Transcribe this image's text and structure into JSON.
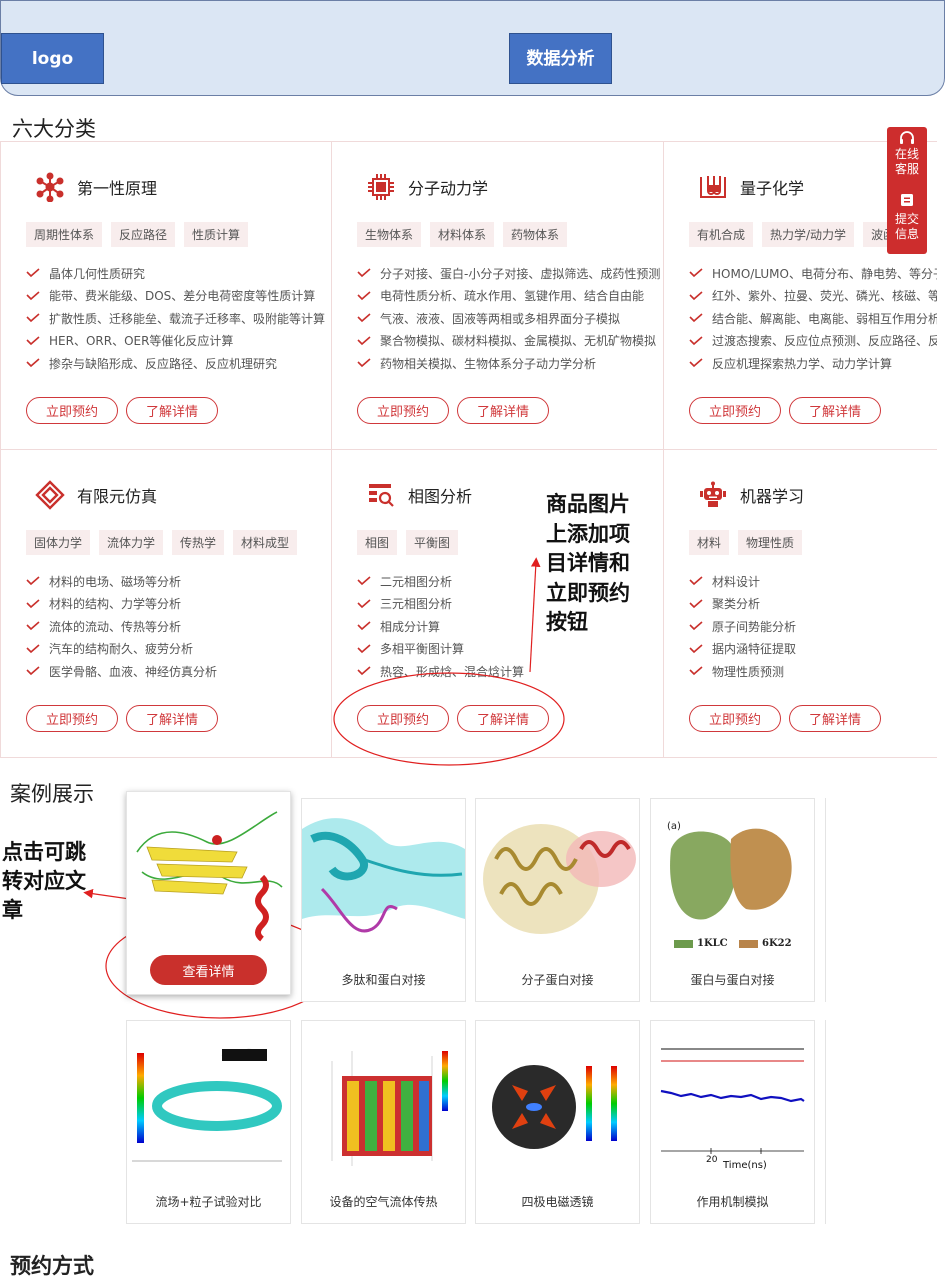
{
  "header": {
    "logo": "logo",
    "data_analysis": "数据分析"
  },
  "categories_title": "六大分类",
  "categories": [
    {
      "title": "第一性原理",
      "icon": "network-nodes-icon",
      "tags": [
        "周期性体系",
        "反应路径",
        "性质计算"
      ],
      "features": [
        "晶体几何性质研究",
        "能带、费米能级、DOS、差分电荷密度等性质计算",
        "扩散性质、迁移能垒、载流子迁移率、吸附能等计算",
        "HER、ORR、OER等催化反应计算",
        "掺杂与缺陷形成、反应路径、反应机理研究"
      ]
    },
    {
      "title": "分子动力学",
      "icon": "chip-icon",
      "tags": [
        "生物体系",
        "材料体系",
        "药物体系"
      ],
      "features": [
        "分子对接、蛋白-小分子对接、虚拟筛选、成药性预测",
        "电荷性质分析、疏水作用、氢键作用、结合自由能",
        "气液、液液、固液等两相或多相界面分子模拟",
        "聚合物模拟、碳材料模拟、金属模拟、无机矿物模拟",
        "药物相关模拟、生物体系分子动力学分析"
      ]
    },
    {
      "title": "量子化学",
      "icon": "test-tubes-icon",
      "tags": [
        "有机合成",
        "热力学/动力学",
        "波函数"
      ],
      "features": [
        "HOMO/LUMO、电荷分布、静电势、等分子性质",
        "红外、紫外、拉曼、荧光、磷光、核磁、等光谱",
        "结合能、解离能、电离能、弱相互作用分析等",
        "过渡态搜索、反应位点预测、反应路径、反应机理",
        "反应机理探索热力学、动力学计算"
      ]
    },
    {
      "title": "有限元仿真",
      "icon": "diamond-mesh-icon",
      "tags": [
        "固体力学",
        "流体力学",
        "传热学",
        "材料成型"
      ],
      "features": [
        "材料的电场、磁场等分析",
        "材料的结构、力学等分析",
        "流体的流动、传热等分析",
        "汽车的结构耐久、疲劳分析",
        "医学骨骼、血液、神经仿真分析"
      ]
    },
    {
      "title": "相图分析",
      "icon": "phase-search-icon",
      "tags": [
        "相图",
        "平衡图"
      ],
      "features": [
        "二元相图分析",
        "三元相图分析",
        "相成分计算",
        "多相平衡图计算",
        "热容、形成焓、混合焓计算"
      ]
    },
    {
      "title": "机器学习",
      "icon": "robot-icon",
      "tags": [
        "材料",
        "物理性质"
      ],
      "features": [
        "材料设计",
        "聚类分析",
        "原子间势能分析",
        "据内涵特征提取",
        "物理性质预测"
      ]
    }
  ],
  "buttons": {
    "book": "立即预约",
    "details": "了解详情"
  },
  "side_float": {
    "service": "在线客服",
    "submit": "提交信息"
  },
  "annotations": {
    "product_note": "商品图片上添加项目详情和立即预约按钮",
    "click_note": "点击可跳转对应文章"
  },
  "cases_title": "案例展示",
  "cases": [
    {
      "label": "",
      "button": "查看详情"
    },
    {
      "label": "多肽和蛋白对接"
    },
    {
      "label": "分子蛋白对接"
    },
    {
      "label": "蛋白与蛋白对接",
      "panel": "(a)",
      "legend": [
        "1KLC",
        "6K22"
      ]
    },
    {
      "label": "流场+粒子试验对比"
    },
    {
      "label": "设备的空气流体传热"
    },
    {
      "label": "四极电磁透镜"
    },
    {
      "label": "作用机制模拟",
      "axis_label": "Time(ns)",
      "axis_tick": "20"
    }
  ],
  "booking_title": "预约方式",
  "colors": {
    "accent": "#d0383b",
    "header_bg": "#dbe6f4",
    "blue_btn": "#4472c4"
  }
}
